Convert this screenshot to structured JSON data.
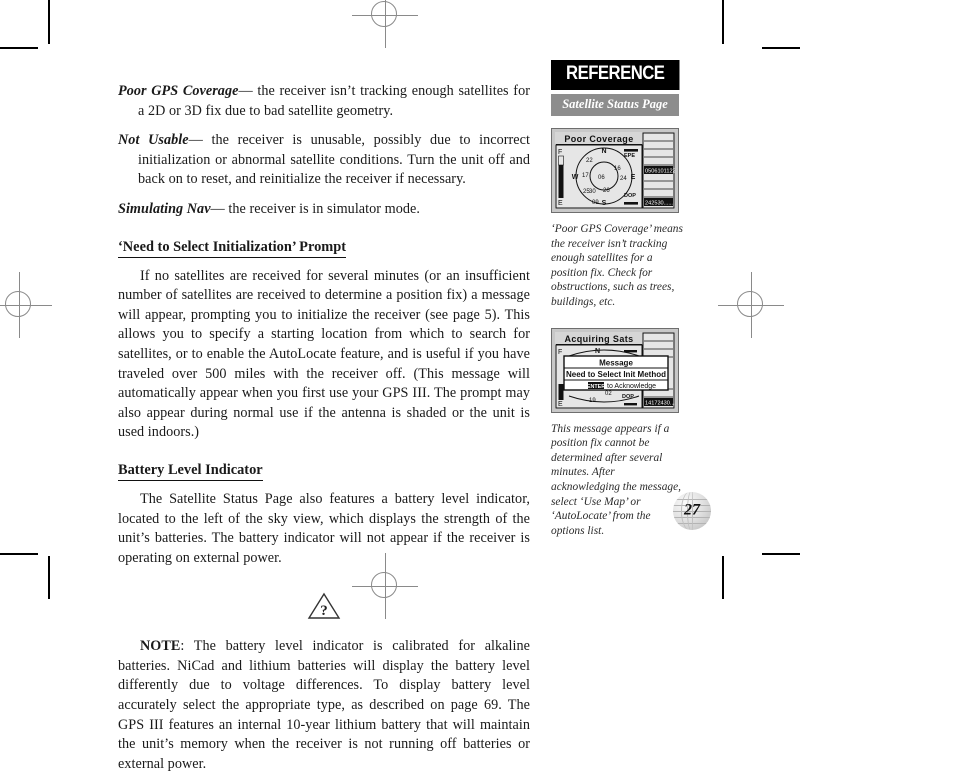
{
  "page": {
    "number": "27"
  },
  "body": {
    "paragraphs": [
      {
        "lead": "Poor GPS Coverage",
        "text": "— the receiver isn’t tracking enough satellites for a 2D or 3D fix due to bad satellite geometry."
      },
      {
        "lead": "Not Usable",
        "text": "— the receiver is unusable, possibly due to incorrect initialization or abnormal satellite conditions. Turn the unit off and back on to reset, and reinitialize the receiver if necessary."
      },
      {
        "lead": "Simulating Nav",
        "text": "— the receiver is in simulator mode."
      }
    ],
    "section_one": {
      "heading": "‘Need to Select Initialization’ Prompt",
      "text": "If no satellites are received for several minutes (or an insufficient number of satellites are received to determine a position fix) a message will appear, prompting you to initialize the receiver (see page 5). This allows you to specify a starting location from which to search for satellites, or to enable the AutoLocate feature, and is useful if you have traveled over 500 miles with the receiver off. (This message will automatically appear when you first use your GPS III. The prompt may also appear during normal use if the antenna is shaded or the unit is used indoors.)"
    },
    "section_two": {
      "heading": "Battery Level Indicator",
      "text": "The Satellite Status Page also features a battery level indicator, located to the left of the sky view, which displays the strength of the unit’s batteries. The battery indicator will not appear if the receiver is operating on external power."
    },
    "note": {
      "icon": "warning-question-triangle-icon",
      "label": "NOTE",
      "text": ": The battery level indicator is calibrated for alkaline batteries. NiCad and lithium batteries will display the battery level differently due to voltage differences. To display battery level accurately select the appropriate type, as described on page 69. The GPS III features an internal 10-year lithium battery that will maintain the unit’s memory when the receiver is not running off batteries or external power."
    }
  },
  "sidebar": {
    "banner": "REFERENCE",
    "subbanner": "Satellite Status Page",
    "figures": [
      {
        "name": "poor-coverage-screenshot",
        "lcd": {
          "title": "Poor Coverage",
          "battery_labels": [
            "F",
            "E"
          ],
          "compass_labels": [
            "N",
            "S",
            "E",
            "W"
          ],
          "satellites": [
            "22",
            "17",
            "16",
            "06",
            "24",
            "25",
            "30",
            "26",
            "09"
          ],
          "epe_label": "EPE",
          "dop_label": "DOP",
          "epe_value": "- - - -",
          "dop_value": "- - - -",
          "bar_labels_top": "05 06 10 11 22 23",
          "bar_labels_bottom": "24 25 30 . . . . . ."
        },
        "caption": "‘Poor GPS Coverage’ means the receiver isn’t tracking enough satellites for a position fix. Check for obstructions, such as trees, buildings, etc."
      },
      {
        "name": "acquiring-sats-screenshot",
        "lcd": {
          "title": "Acquiring Sats",
          "battery_labels": [
            "F",
            "E"
          ],
          "compass_labels": [
            "N"
          ],
          "satellites": [
            "02",
            "19"
          ],
          "dop_label": "DOP",
          "dop_value": "- - - -",
          "bar_labels_bottom": "14 17 22 24 30 . . . . .",
          "dialog": {
            "title": "Message",
            "body": "Need to Select Init Method",
            "key": "ENTER",
            "hint": "to Acknowledge"
          }
        },
        "caption": "This message appears if a position fix cannot be determined after several minutes. After acknowledging the message, select ‘Use Map’ or ‘AutoLocate’ from the options list."
      }
    ]
  },
  "colors": {
    "banner_bg": "#000000",
    "subbanner_bg": "#8d8d8d",
    "lcd_bg": "#d6d6d6",
    "frame_bg": "#c8c8c8"
  }
}
